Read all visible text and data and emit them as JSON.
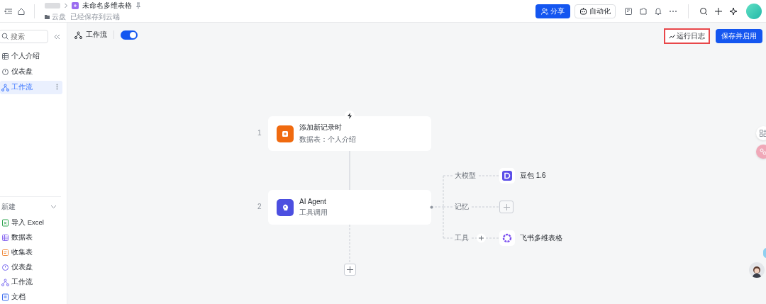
{
  "topbar": {
    "title": "未命名多维表格",
    "location": "云盘",
    "save_status": "已经保存到云端",
    "share_button": "分享",
    "automation_button": "自动化"
  },
  "sidebar": {
    "search": {
      "placeholder": "搜索"
    },
    "items": [
      {
        "label": "个人介绍",
        "kind": "table",
        "selected": false
      },
      {
        "label": "仪表盘",
        "kind": "dashboard",
        "selected": false
      },
      {
        "label": "工作流",
        "kind": "workflow",
        "selected": true
      }
    ],
    "new_section": {
      "label": "新建",
      "items": [
        {
          "label": "导入 Excel",
          "kind": "excel"
        },
        {
          "label": "数据表",
          "kind": "table"
        },
        {
          "label": "收集表",
          "kind": "form"
        },
        {
          "label": "仪表盘",
          "kind": "dashboard"
        },
        {
          "label": "工作流",
          "kind": "workflow"
        },
        {
          "label": "文档",
          "kind": "doc"
        }
      ]
    }
  },
  "canvas": {
    "header": {
      "label": "工作流",
      "enabled": true
    },
    "run_log_button": "运行日志",
    "save_button": "保存并启用",
    "nodes": [
      {
        "number": "1",
        "title": "添加新记录时",
        "subtitle": "数据表：个人介绍",
        "kind": "trigger"
      },
      {
        "number": "2",
        "title": "AI Agent",
        "subtitle": "工具调用",
        "kind": "agent"
      }
    ],
    "branches": [
      {
        "label": "大模型",
        "add_button": false,
        "target": {
          "kind": "model",
          "label": "豆包 1.6"
        }
      },
      {
        "label": "记忆",
        "add_button": false,
        "target": {
          "kind": "add"
        }
      },
      {
        "label": "工具",
        "add_button": true,
        "target": {
          "kind": "tool",
          "label": "飞书多维表格"
        }
      }
    ]
  }
}
